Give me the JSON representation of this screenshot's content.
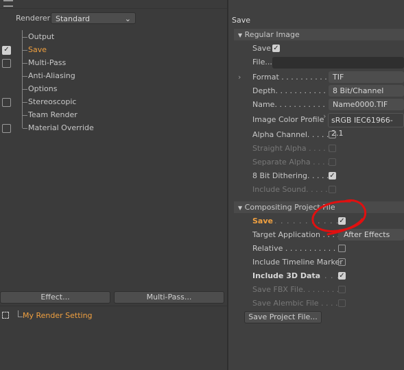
{
  "renderer": {
    "label": "Renderer",
    "value": "Standard"
  },
  "tree": [
    {
      "label": "Output",
      "checkbox": null
    },
    {
      "label": "Save",
      "checkbox": true,
      "active": true
    },
    {
      "label": "Multi-Pass",
      "checkbox": false
    },
    {
      "label": "Anti-Aliasing",
      "checkbox": null
    },
    {
      "label": "Options",
      "checkbox": null
    },
    {
      "label": "Stereoscopic",
      "checkbox": false
    },
    {
      "label": "Team Render",
      "checkbox": null
    },
    {
      "label": "Material Override",
      "checkbox": false
    }
  ],
  "buttons": {
    "effect": "Effect...",
    "multipass": "Multi-Pass..."
  },
  "render_setting": "My Render Setting",
  "panel": {
    "title": "Save",
    "regular": {
      "header": "Regular Image",
      "save": "Save",
      "file": "File...",
      "format_label": "Format . . . . . . . . . .",
      "format_value": "TIF",
      "depth_label": "Depth. . . . . . . . . . .",
      "depth_value": "8 Bit/Channel",
      "name_label": "Name. . . . . . . . . . .",
      "name_value": "Name0000.TIF",
      "profile_label": "Image Color Profile",
      "profile_value": "sRGB IEC61966-2.1",
      "alpha": "Alpha Channel. . . . .",
      "straight": "Straight Alpha . . . . .",
      "separate": "Separate Alpha . . . .",
      "dither": "8 Bit Dithering. . . . .",
      "sound": "Include Sound. . . . ."
    },
    "compositing": {
      "header": "Compositing Project File",
      "save": "Save",
      "save_dots": ". . . . . . . . . . .",
      "target_label": "Target Application . . . .",
      "target_value": "After Effects",
      "relative": "Relative . . . . . . . . . . .",
      "timeline": "Include Timeline Marker",
      "data3d": "Include 3D Data",
      "data3d_dots": ". . . . .",
      "fbx": "Save FBX File. . . . . . . .",
      "alembic": "Save Alembic File . . . .",
      "save_project": "Save Project File..."
    }
  },
  "annotation_color": "#e01010"
}
